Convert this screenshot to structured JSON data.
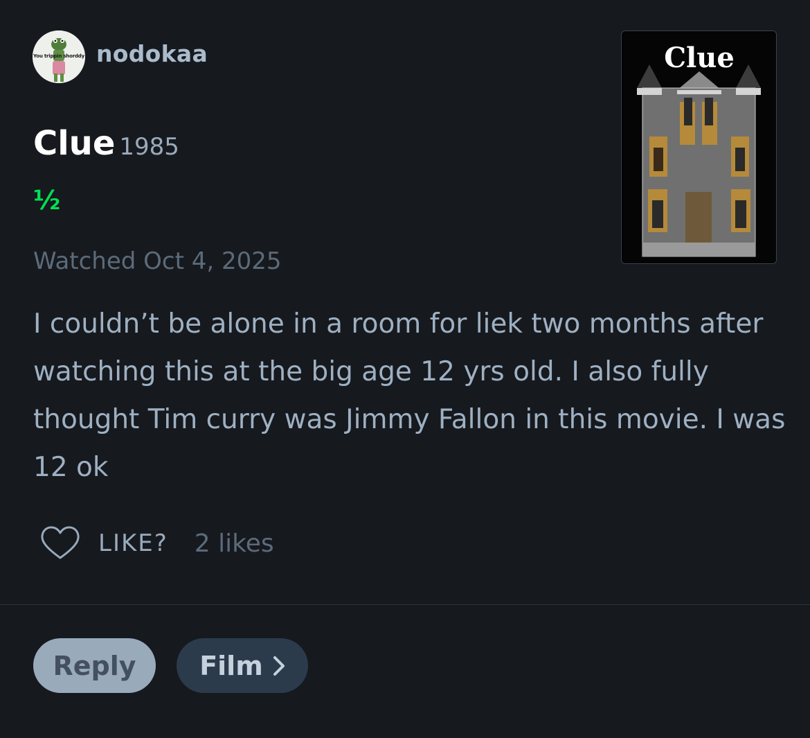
{
  "user": {
    "username": "nodokaa",
    "avatar_caption": "You trippin shorddy",
    "avatar_icon": "frog-figure-avatar-icon"
  },
  "film": {
    "title": "Clue",
    "year": "1985",
    "rating_text": "½",
    "rating_stars": 0.5,
    "watched_text": "Watched Oct 4, 2025",
    "poster_title": "Clue",
    "poster_icon": "haunted-mansion-poster"
  },
  "review": {
    "text": "I couldn’t be alone in a room for liek two months after watching this at the big age 12 yrs old. I also fully thought Tim curry was Jimmy Fallon in this movie. I was 12 ok"
  },
  "actions": {
    "like_label": "LIKE?",
    "like_icon": "heart-outline-icon",
    "likes_count": "2 likes"
  },
  "buttons": {
    "reply": "Reply",
    "film": "Film",
    "film_icon": "chevron-right-icon"
  },
  "colors": {
    "background": "#16191e",
    "rating_green": "#00e054",
    "text_muted": "#99aabb",
    "text_dim": "#5c6b7a",
    "reply_button": "#99aabb",
    "film_button": "#2c3b4b"
  }
}
